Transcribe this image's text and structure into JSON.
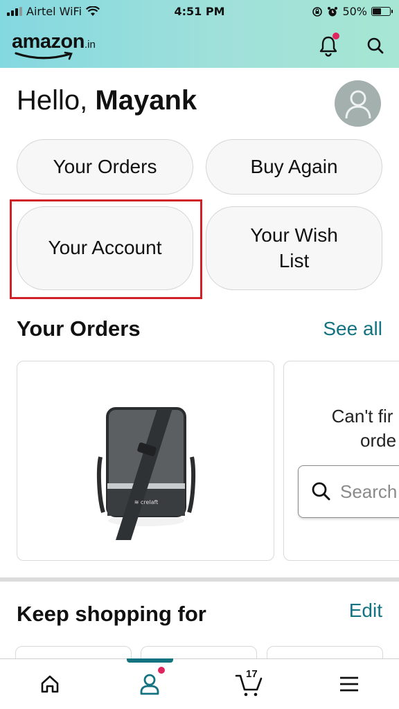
{
  "status_bar": {
    "carrier": "Airtel WiFi",
    "time": "4:51 PM",
    "battery": "50%",
    "battery_level": 0.5
  },
  "header": {
    "logo_word": "amazon",
    "logo_tld": ".in",
    "icons": [
      "bell-icon",
      "search-icon"
    ],
    "notification_dot_color": "#e0245e"
  },
  "greeting": {
    "prefix": "Hello, ",
    "name": "Mayank"
  },
  "quick_actions": [
    {
      "label": "Your Orders"
    },
    {
      "label": "Buy Again"
    },
    {
      "label": "Your Account",
      "highlighted": true
    },
    {
      "label": "Your Wish List"
    }
  ],
  "orders": {
    "title": "Your Orders",
    "link": "See all",
    "cant_find_line1": "Can't fir",
    "cant_find_line2": "orde",
    "search_placeholder": "Search"
  },
  "keep_shopping": {
    "title": "Keep shopping for",
    "link": "Edit"
  },
  "bottom_nav": {
    "items": [
      "home-icon",
      "account-icon",
      "cart-icon",
      "menu-icon"
    ],
    "active": "account",
    "cart_count": "17"
  },
  "colors": {
    "accent_teal": "#137380",
    "highlight_red": "#d0202a"
  }
}
